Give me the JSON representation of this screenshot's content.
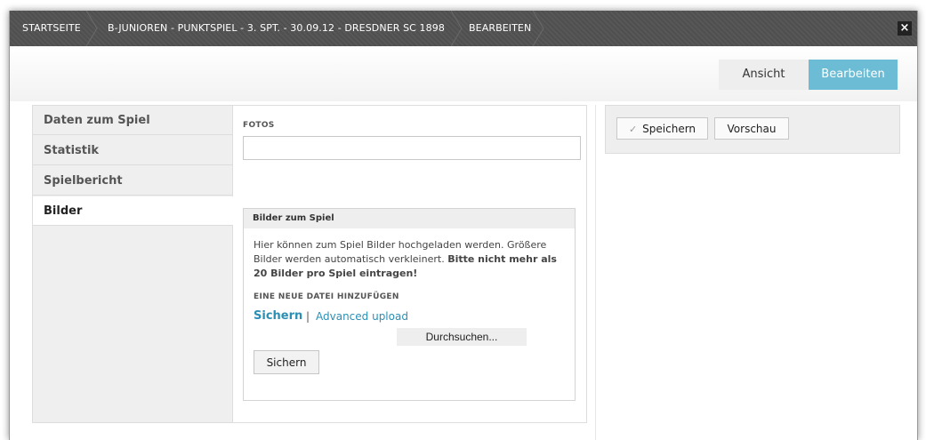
{
  "breadcrumb": {
    "items": [
      {
        "label": "STARTSEITE"
      },
      {
        "label": "B-JUNIOREN - PUNKTSPIEL - 3. SPT. - 30.09.12 - DRESDNER SC 1898"
      },
      {
        "label": "BEARBEITEN"
      }
    ]
  },
  "window": {
    "close_icon": "×"
  },
  "view_toggle": {
    "ansicht_label": "Ansicht",
    "bearbeiten_label": "Bearbeiten",
    "active_color": "#6bbcd4"
  },
  "sidebar": {
    "items": [
      {
        "label": "Daten zum Spiel"
      },
      {
        "label": "Statistik"
      },
      {
        "label": "Spielbericht"
      },
      {
        "label": "Bilder",
        "active": true
      }
    ]
  },
  "main": {
    "fotos_label": "FOTOS",
    "fotos_value": "",
    "box": {
      "title": "Bilder zum Spiel",
      "description_part1": "Hier können zum Spiel Bilder hochgeladen werden. Größere Bilder werden automatisch verkleinert. ",
      "description_bold": "Bitte nicht mehr als 20 Bilder pro Spiel eintragen!",
      "add_file_label": "EINE NEUE DATEI HINZUFÜGEN",
      "link_sichern": "Sichern",
      "link_divider": "|",
      "link_advanced": "Advanced upload",
      "browse_label": "Durchsuchen...",
      "submit_label": "Sichern"
    }
  },
  "actions": {
    "save_icon": "✓",
    "save_label": "Speichern",
    "preview_label": "Vorschau"
  }
}
